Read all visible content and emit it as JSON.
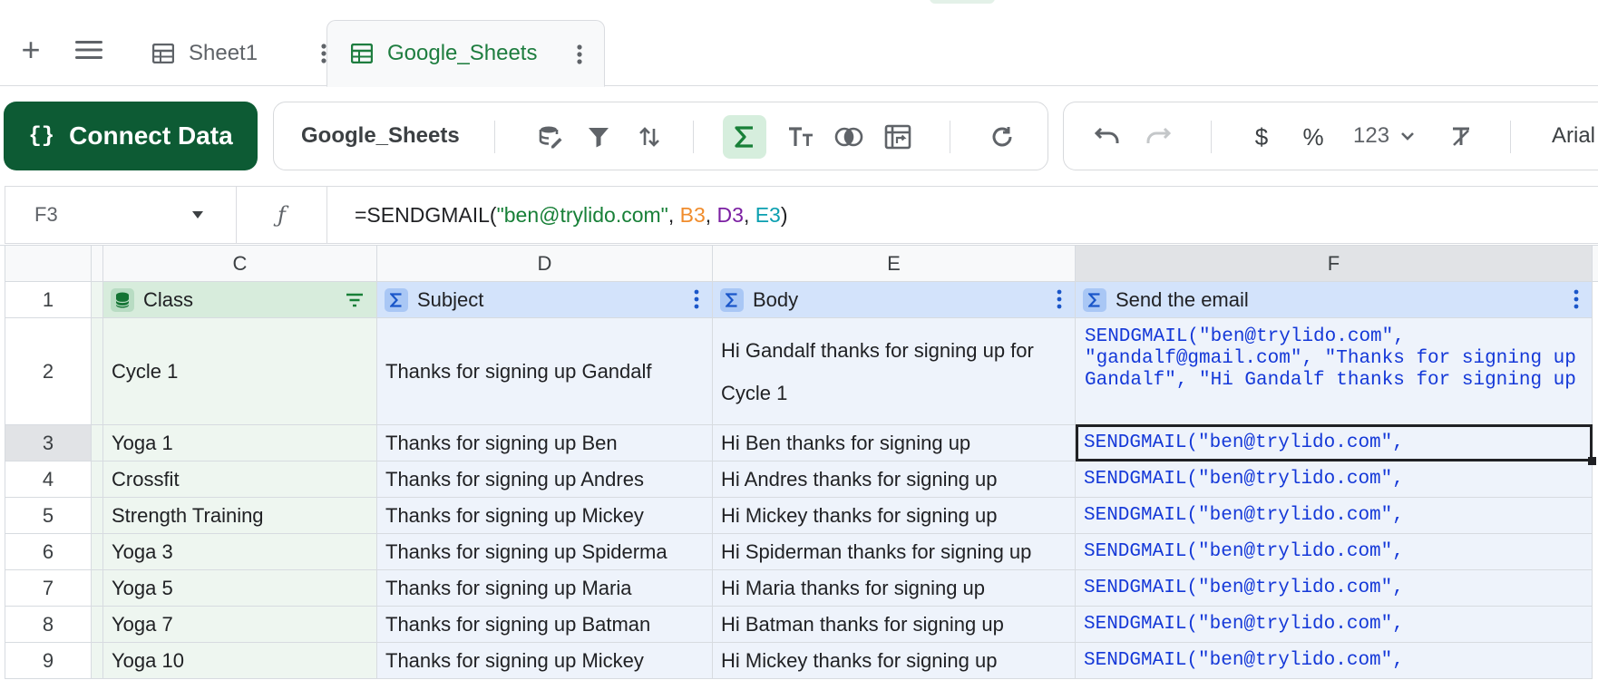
{
  "tabs": {
    "add_label": "+",
    "items": [
      {
        "label": "Sheet1",
        "active": false
      },
      {
        "label": "Google_Sheets",
        "active": true
      }
    ]
  },
  "toolbar": {
    "connect_label": "Connect Data",
    "connect_glyph": "{}",
    "source_name": "Google_Sheets",
    "number_format_label": "123",
    "currency_glyph": "$",
    "percent_glyph": "%",
    "font_name": "Arial",
    "icons": [
      "database-edit-icon",
      "filter-icon",
      "sort-icon",
      "sigma-icon",
      "text-size-icon",
      "merge-icon",
      "pivot-icon",
      "refresh-icon",
      "undo-icon",
      "redo-icon",
      "currency-icon",
      "percent-icon",
      "clear-format-icon"
    ]
  },
  "formula_bar": {
    "cell_ref": "F3",
    "fx_glyph": "ƒ",
    "prefix": "=SENDGMAIL(",
    "string_arg": "\"ben@trylido.com\"",
    "sep1": ", ",
    "ref_b": "B3",
    "sep2": ", ",
    "ref_d": "D3",
    "sep3": ", ",
    "ref_e": "E3",
    "suffix": ")"
  },
  "grid": {
    "col_headers": [
      "C",
      "D",
      "E",
      "F"
    ],
    "header_row": {
      "class": "Class",
      "subject": "Subject",
      "body": "Body",
      "send": "Send the email"
    },
    "rows": [
      {
        "num": "1"
      },
      {
        "num": "2",
        "class": "Cycle 1",
        "subject": "Thanks for signing up Gandalf",
        "body": "Hi Gandalf thanks for signing up for Cycle 1",
        "send": "SENDGMAIL(\"ben@trylido.com\", \"gandalf@gmail.com\", \"Thanks for signing up Gandalf\", \"Hi Gandalf thanks for signing up"
      },
      {
        "num": "3",
        "class": "Yoga 1",
        "subject": "Thanks for signing up Ben",
        "body": "Hi Ben thanks for signing up",
        "send": "SENDGMAIL(\"ben@trylido.com\","
      },
      {
        "num": "4",
        "class": "Crossfit",
        "subject": "Thanks for signing up Andres",
        "body": "Hi Andres thanks for signing up",
        "send": "SENDGMAIL(\"ben@trylido.com\","
      },
      {
        "num": "5",
        "class": "Strength Training",
        "subject": "Thanks for signing up Mickey",
        "body": "Hi Mickey thanks for signing up",
        "send": "SENDGMAIL(\"ben@trylido.com\","
      },
      {
        "num": "6",
        "class": "Yoga 3",
        "subject": "Thanks for signing up Spiderma",
        "body": "Hi Spiderman thanks for signing up",
        "send": "SENDGMAIL(\"ben@trylido.com\","
      },
      {
        "num": "7",
        "class": "Yoga 5",
        "subject": "Thanks for signing up Maria",
        "body": "Hi Maria thanks for signing up",
        "send": "SENDGMAIL(\"ben@trylido.com\","
      },
      {
        "num": "8",
        "class": "Yoga 7",
        "subject": "Thanks for signing up Batman",
        "body": "Hi Batman thanks for signing up",
        "send": "SENDGMAIL(\"ben@trylido.com\","
      },
      {
        "num": "9",
        "class": "Yoga 10",
        "subject": "Thanks for signing up Mickey",
        "body": "Hi Mickey thanks for signing up",
        "send": "SENDGMAIL(\"ben@trylido.com\","
      }
    ],
    "selected_cell": "F3",
    "colors": {
      "class_col": "#eef6f0",
      "blue_col": "#eef3fb",
      "formula_text": "#1438d8",
      "brand_green": "#0d5b34"
    }
  }
}
